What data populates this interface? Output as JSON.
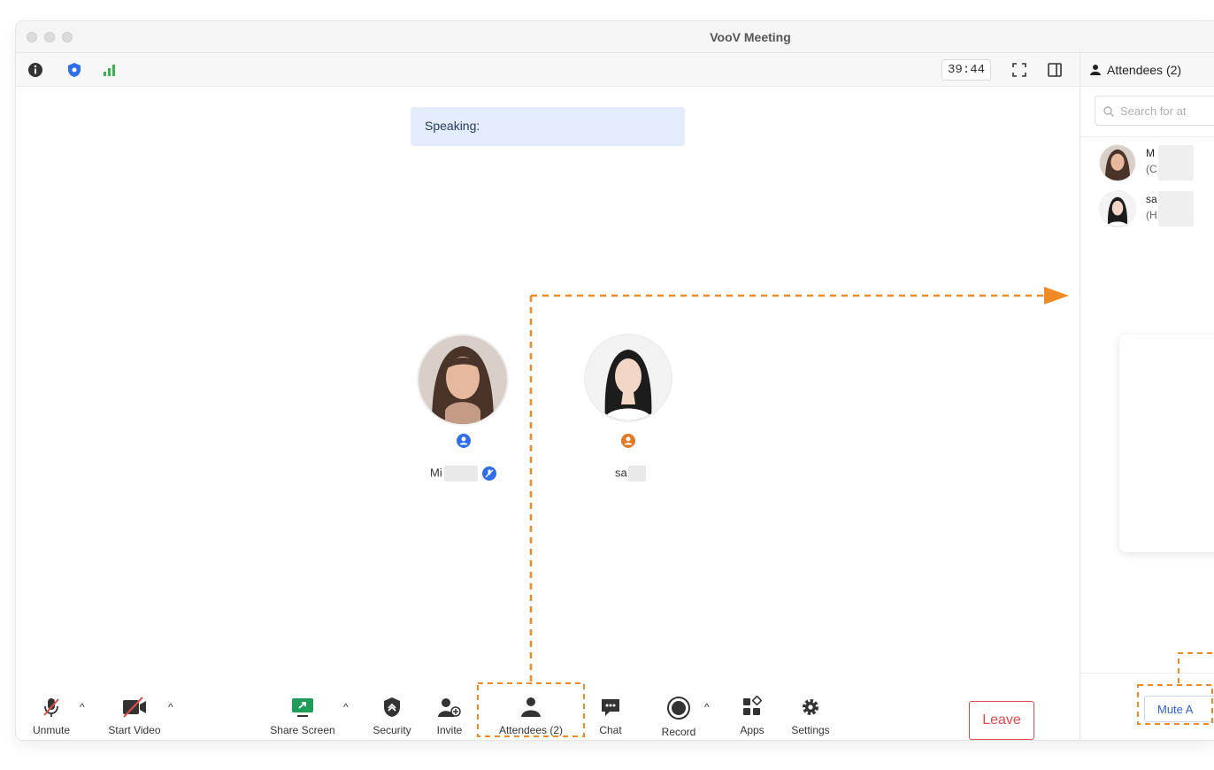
{
  "window": {
    "title": "VooV Meeting"
  },
  "infobar": {
    "timer": "39:44"
  },
  "speaking": {
    "label": "Speaking:"
  },
  "participants": [
    {
      "name_visible": "Mi"
    },
    {
      "name_visible": "sa"
    }
  ],
  "toolbar": {
    "unmute": "Unmute",
    "start_video": "Start Video",
    "share_screen": "Share Screen",
    "security": "Security",
    "invite": "Invite",
    "attendees": "Attendees (2)",
    "chat": "Chat",
    "record": "Record",
    "apps": "Apps",
    "settings": "Settings",
    "leave": "Leave"
  },
  "sidebar": {
    "title": "Attendees (2)",
    "search_placeholder": "Search for at",
    "attendees": [
      {
        "name": "M",
        "role": "(C"
      },
      {
        "name": "sa",
        "role": "(H"
      }
    ],
    "mute_all": "Mute A"
  },
  "colors": {
    "accent_blue": "#2f5fd6",
    "speaking_bg": "#e3ecfb",
    "leave_red": "#e24b4b",
    "annotation_orange": "#f08a24",
    "signal_green": "#3bb54a"
  }
}
